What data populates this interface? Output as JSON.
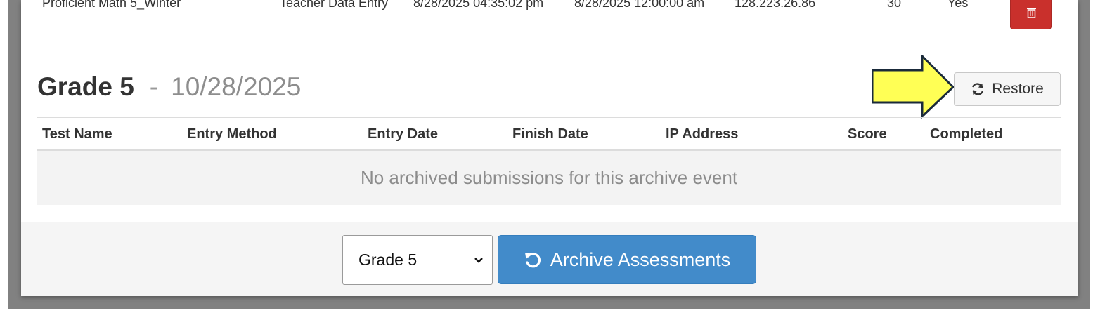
{
  "previous_row": {
    "test_name": "Proficient Math 5_Winter",
    "entry_method": "Teacher Data Entry",
    "entry_date": "8/28/2025 04:35:02 pm",
    "finish_date": "8/28/2025 12:00:00 am",
    "ip_address": "128.223.26.86",
    "score": "30",
    "completed": "Yes",
    "delete_icon": "trash-icon"
  },
  "archive_event": {
    "grade": "Grade 5",
    "separator": "-",
    "date": "10/28/2025",
    "restore_label": "Restore",
    "restore_icon": "refresh-icon",
    "callout_color": "#ffff55"
  },
  "table": {
    "columns": [
      "Test Name",
      "Entry Method",
      "Entry Date",
      "Finish Date",
      "IP Address",
      "Score",
      "Completed"
    ],
    "empty_message": "No archived submissions for this archive event"
  },
  "footer": {
    "grade_select": {
      "selected": "Grade 5"
    },
    "archive_button_label": "Archive Assessments",
    "archive_button_icon": "undo-icon",
    "accent": "#428bca"
  }
}
